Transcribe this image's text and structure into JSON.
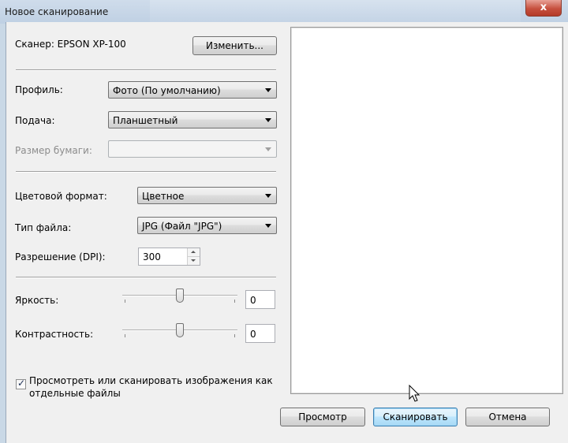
{
  "window": {
    "title": "Новое сканирование",
    "close_glyph": "x"
  },
  "scanner": {
    "label": "Сканер: EPSON XP-100",
    "change_button": "Изменить..."
  },
  "profile": {
    "label": "Профиль:",
    "value": "Фото (По умолчанию)"
  },
  "feed": {
    "label": "Подача:",
    "value": "Планшетный"
  },
  "paper_size": {
    "label": "Размер бумаги:",
    "value": "",
    "enabled": false
  },
  "color_format": {
    "label": "Цветовой формат:",
    "value": "Цветное"
  },
  "file_type": {
    "label": "Тип файла:",
    "value": "JPG (Файл \"JPG\")"
  },
  "resolution": {
    "label": "Разрешение (DPI):",
    "value": "300"
  },
  "brightness": {
    "label": "Яркость:",
    "value": "0",
    "slider_fraction": 0.5
  },
  "contrast": {
    "label": "Контрастность:",
    "value": "0",
    "slider_fraction": 0.5
  },
  "separate_files": {
    "checked": true,
    "label_line1": "Просмотреть или сканировать изображения как",
    "label_line2": "отдельные файлы"
  },
  "buttons": {
    "preview": "Просмотр",
    "scan": "Сканировать",
    "cancel": "Отмена"
  }
}
